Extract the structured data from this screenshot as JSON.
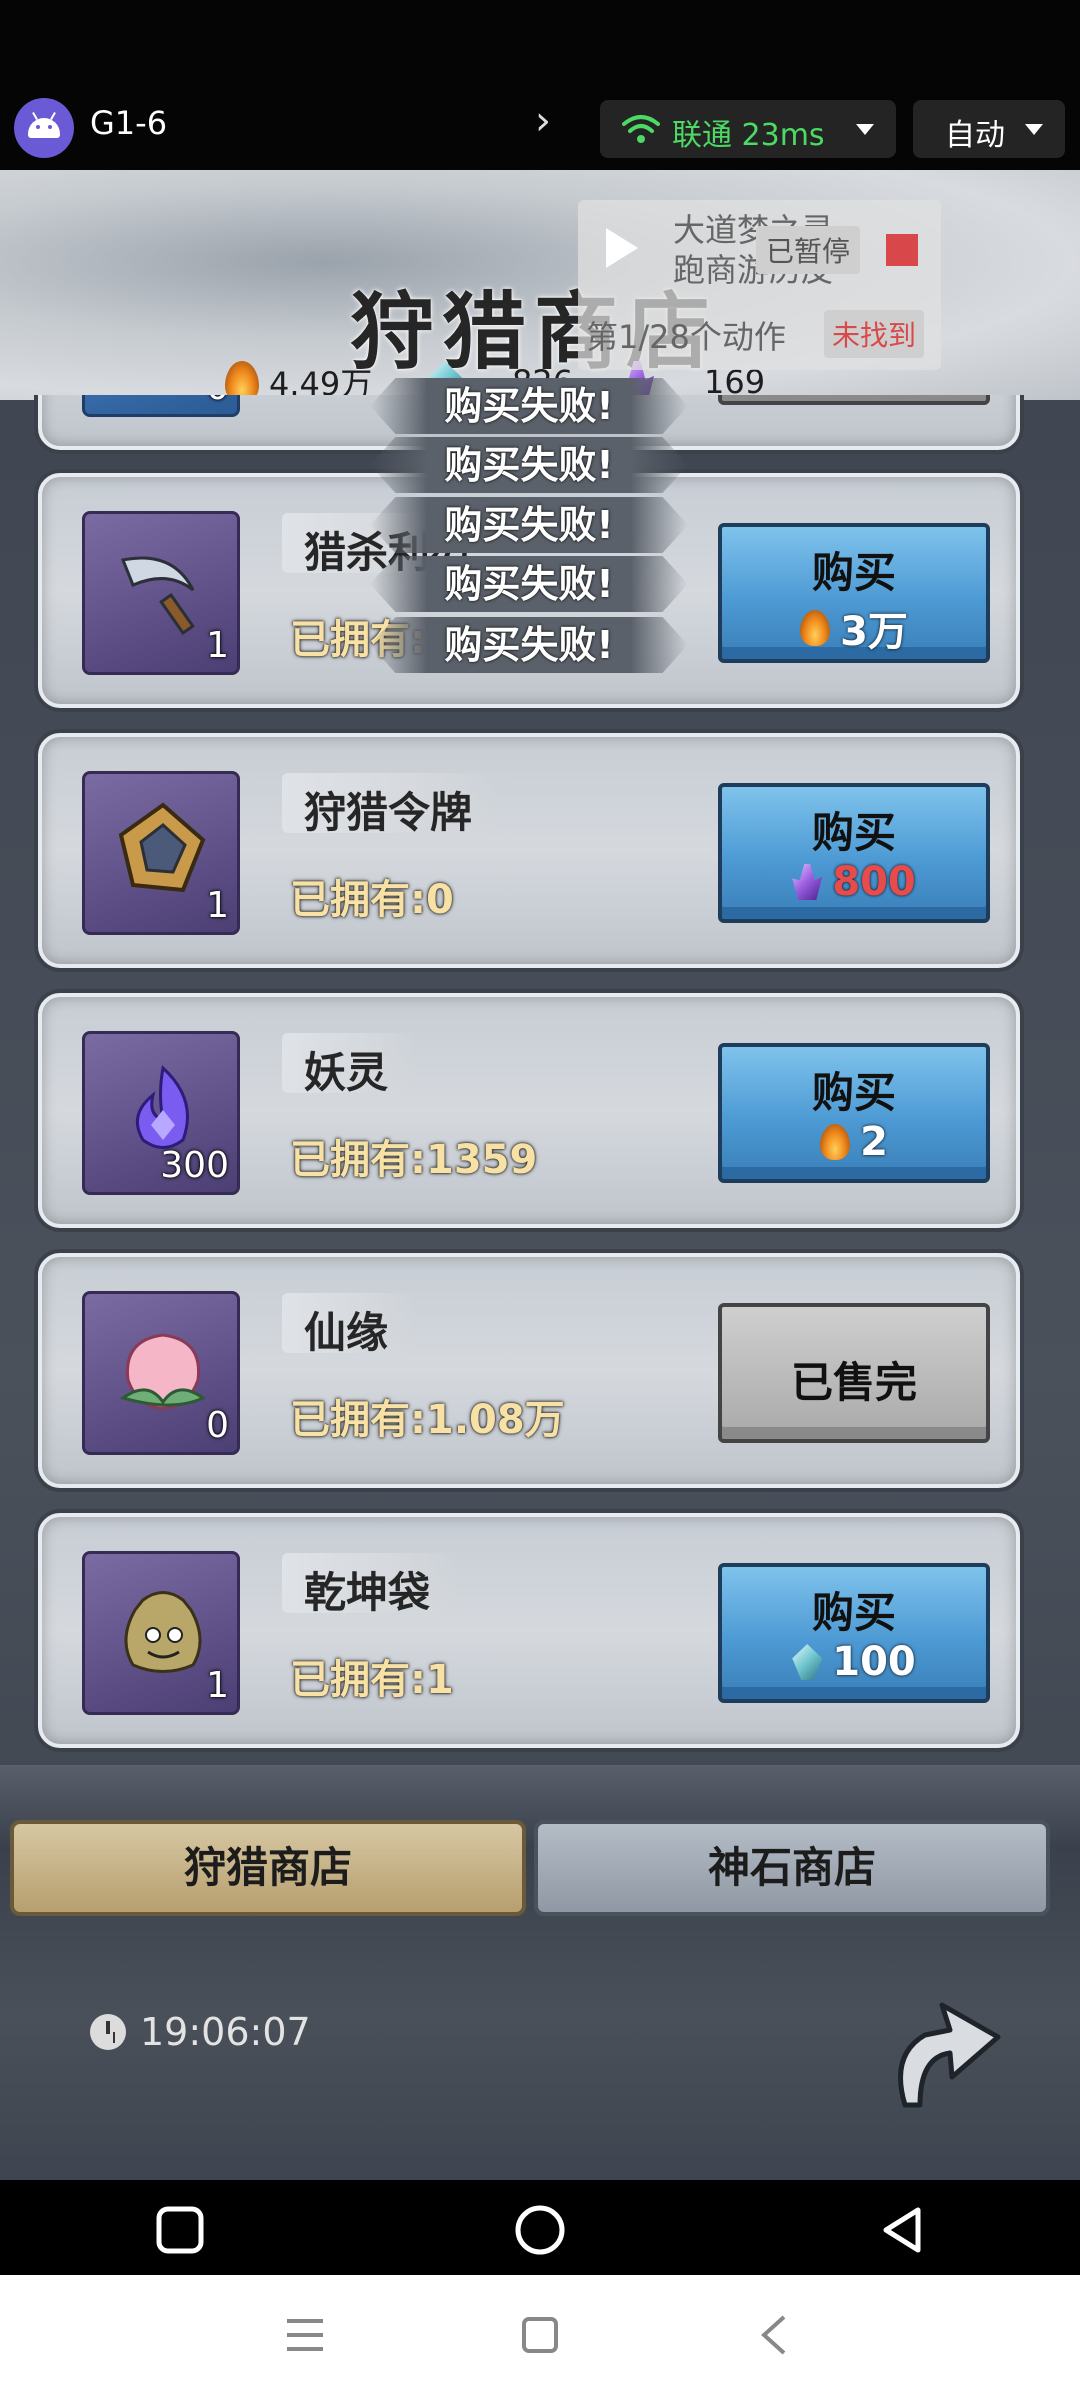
{
  "remote_bar": {
    "device_name": "G1-6",
    "network": "联通 23ms",
    "mode": "自动"
  },
  "automation_overlay": {
    "script_name": "大道梦之灵 跑商游历皮",
    "status": "已暂停",
    "step_text": "第1/28个动作",
    "result": "未找到"
  },
  "shop": {
    "title": "狩猎商店",
    "currencies": [
      {
        "icon": "flame-coin-icon",
        "value": "4.49万"
      },
      {
        "icon": "jade-gem-icon",
        "value": "826"
      },
      {
        "icon": "purple-crystal-icon",
        "value": "169"
      }
    ],
    "partial_top_item": {
      "quantity": "0"
    },
    "items": [
      {
        "name": "猎杀利刃",
        "owned": "已拥有:0",
        "quantity": "1",
        "icon": "blade-icon",
        "buy_label": "购买",
        "price": "3万",
        "price_icon": "flame-coin-icon",
        "sold_out": false
      },
      {
        "name": "狩猎令牌",
        "owned": "已拥有:0",
        "quantity": "1",
        "icon": "token-icon",
        "buy_label": "购买",
        "price": "800",
        "price_icon": "purple-crystal-icon",
        "sold_out": false
      },
      {
        "name": "妖灵",
        "owned": "已拥有:1359",
        "quantity": "300",
        "icon": "spirit-icon",
        "buy_label": "购买",
        "price": "2",
        "price_icon": "flame-coin-icon",
        "sold_out": false
      },
      {
        "name": "仙缘",
        "owned": "已拥有:1.08万",
        "quantity": "0",
        "icon": "peach-icon",
        "sold_label": "已售完",
        "sold_out": true
      },
      {
        "name": "乾坤袋",
        "owned": "已拥有:1",
        "quantity": "1",
        "icon": "bag-icon",
        "buy_label": "购买",
        "price": "100",
        "price_icon": "jade-gem-icon",
        "sold_out": false
      }
    ],
    "toasts": [
      "购买失败!",
      "购买失败!",
      "购买失败!",
      "购买失败!",
      "购买失败!"
    ],
    "tabs": [
      {
        "label": "狩猎商店",
        "active": true
      },
      {
        "label": "神石商店",
        "active": false
      }
    ],
    "refresh_time": "19:06:07"
  },
  "colors": {
    "buy_button": "#4d9ad4",
    "owned_text": "#f7e1a5",
    "network_green": "#4cd964",
    "price_red": "#e94b4b"
  }
}
